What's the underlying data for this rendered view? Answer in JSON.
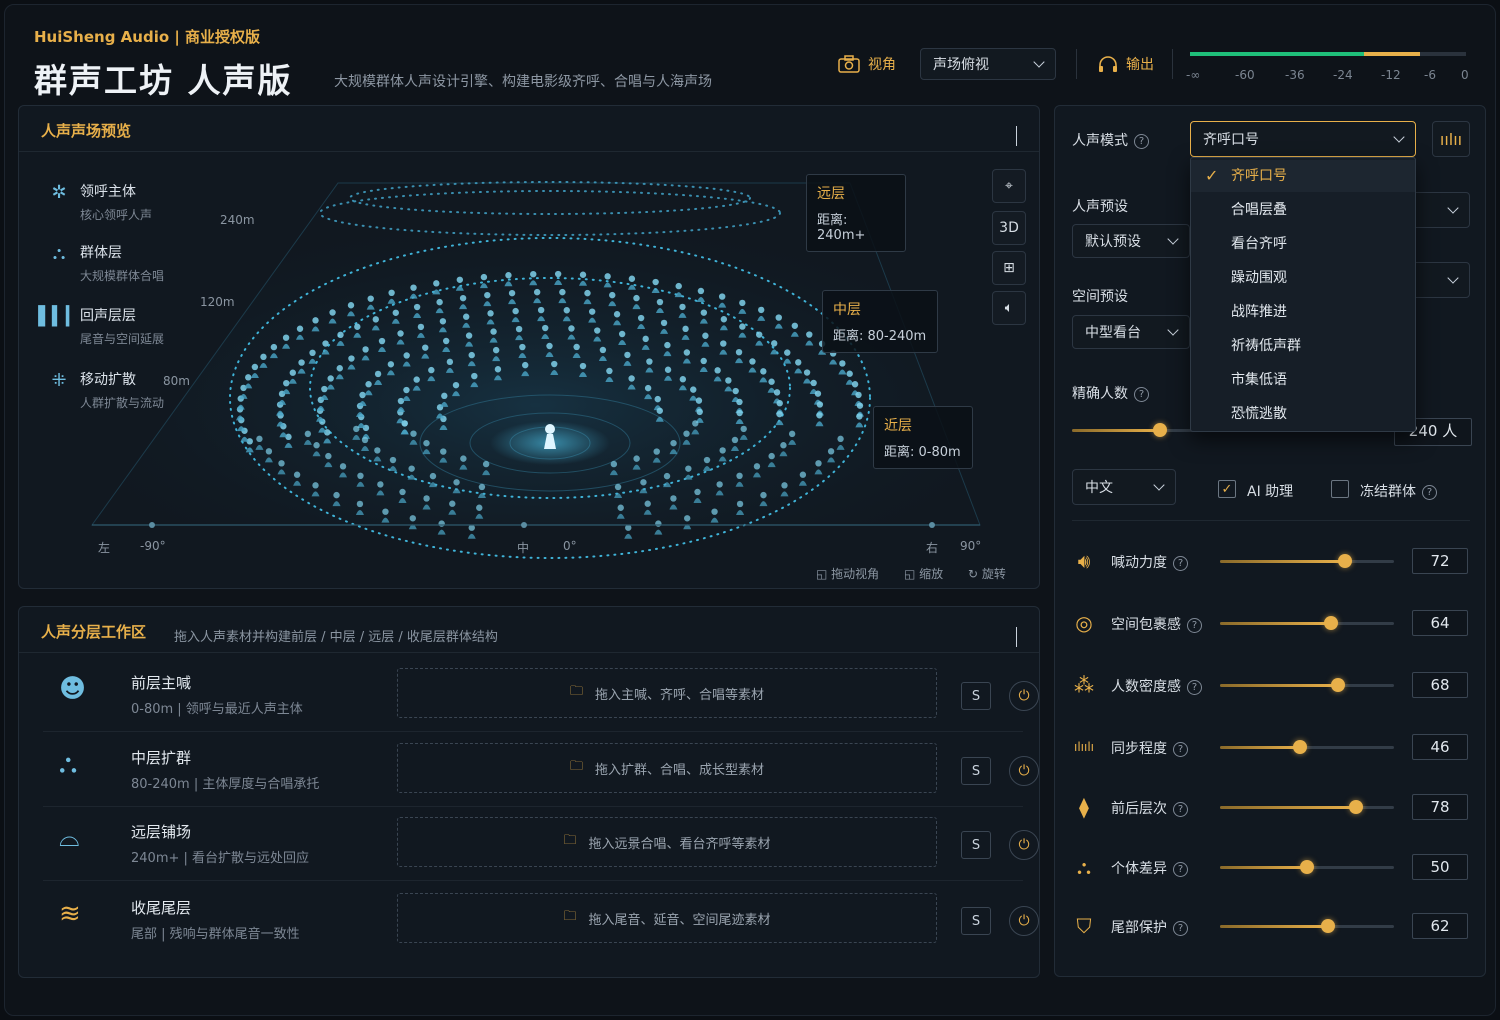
{
  "header": {
    "brand": "HuiSheng Audio | 商业授权版",
    "title": "群声工坊 人声版",
    "subtitle": "大规模群体人声设计引擎、构建电影级齐呼、合唱与人海声场",
    "view_label": "视角",
    "view_select": "声场俯视",
    "output_label": "输出",
    "meter_ticks": [
      "-∞",
      "-60",
      "-36",
      "-24",
      "-12",
      "-6",
      "0"
    ]
  },
  "preview": {
    "title": "人声声场预览",
    "legend": [
      {
        "title": "领呼主体",
        "sub": "核心领呼人声"
      },
      {
        "title": "群体层",
        "sub": "大规模群体合唱"
      },
      {
        "title": "回声层层",
        "sub": "尾音与空间延展"
      },
      {
        "title": "移动扩散",
        "sub": "人群扩散与流动"
      }
    ],
    "distances": [
      "240m",
      "120m",
      "80m"
    ],
    "zones": [
      {
        "title": "远层",
        "dist": "距离: 240m+"
      },
      {
        "title": "中层",
        "dist": "距离: 80-240m"
      },
      {
        "title": "近层",
        "dist": "距离: 0-80m"
      }
    ],
    "tool_3d": "3D",
    "axis": {
      "left": "左",
      "left_deg": "-90°",
      "center": "中",
      "center_deg": "0°",
      "right": "右",
      "right_deg": "90°"
    },
    "hints": [
      "拖动视角",
      "缩放",
      "旋转"
    ]
  },
  "layers": {
    "title": "人声分层工作区",
    "subtitle": "拖入人声素材并构建前层 / 中层 / 远层 / 收尾层群体结构",
    "solo_label": "S",
    "rows": [
      {
        "name": "前层主喊",
        "desc": "0-80m  |  领呼与最近人声主体",
        "drop": "拖入主喊、齐呼、合唱等素材"
      },
      {
        "name": "中层扩群",
        "desc": "80-240m  |  主体厚度与合唱承托",
        "drop": "拖入扩群、合唱、成长型素材"
      },
      {
        "name": "远层铺场",
        "desc": "240m+  |  看台扩散与远处回应",
        "drop": "拖入远景合唱、看台齐呼等素材"
      },
      {
        "name": "收尾尾层",
        "desc": "尾部  |  残响与群体尾音一致性",
        "drop": "拖入尾音、延音、空间尾迹素材"
      }
    ]
  },
  "controls": {
    "mode_label": "人声模式",
    "mode_value": "齐呼口号",
    "mode_options": [
      "齐呼口号",
      "合唱层叠",
      "看台齐呼",
      "躁动围观",
      "战阵推进",
      "祈祷低声群",
      "市集低语",
      "恐慌逃散"
    ],
    "preset_label": "人声预设",
    "preset_value": "默认预设",
    "space_label": "空间预设",
    "space_value": "中型看台",
    "count_label": "精确人数",
    "count_value": "240 人",
    "count_fraction": 0.3,
    "lang_value": "中文",
    "ai_label": "AI 助理",
    "ai_checked": true,
    "freeze_label": "冻结群体",
    "freeze_checked": false,
    "params": [
      {
        "label": "喊动力度",
        "value": 72,
        "icon": "speaker-icon"
      },
      {
        "label": "空间包裹感",
        "value": 64,
        "icon": "globe-icon"
      },
      {
        "label": "人数密度感",
        "value": 68,
        "icon": "crowd-icon"
      },
      {
        "label": "同步程度",
        "value": 46,
        "icon": "waveform-icon"
      },
      {
        "label": "前后层次",
        "value": 78,
        "icon": "layers-icon"
      },
      {
        "label": "个体差异",
        "value": 50,
        "icon": "people-icon"
      },
      {
        "label": "尾部保护",
        "value": 62,
        "icon": "shield-icon"
      }
    ]
  },
  "colors": {
    "accent": "#e8b04a",
    "cyan": "#6fbde0",
    "meter_green": "#1fbf7a"
  }
}
